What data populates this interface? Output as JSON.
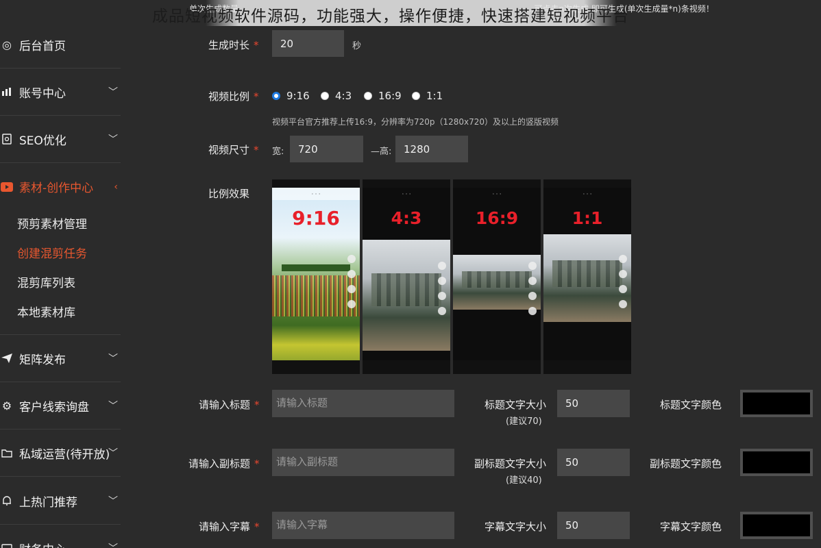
{
  "sidebar": {
    "items": [
      {
        "label": "后台首页",
        "icon": "target-icon"
      },
      {
        "label": "账号中心",
        "icon": "bar-chart-icon"
      },
      {
        "label": "SEO优化",
        "icon": "seo-doc-icon"
      },
      {
        "label": "素材-创作中心",
        "icon": "play-icon"
      },
      {
        "label": "矩阵发布",
        "icon": "send-icon"
      },
      {
        "label": "客户线索询盘",
        "icon": "gear-icon"
      },
      {
        "label": "私域运营(待开放)",
        "icon": "folder-icon"
      },
      {
        "label": "上热门推荐",
        "icon": "bell-icon"
      },
      {
        "label": "财务中心",
        "icon": "wallet-icon"
      }
    ],
    "subitems": [
      "预剪素材管理",
      "创建混剪任务",
      "混剪库列表",
      "本地素材库"
    ],
    "active_color": "#e8572f"
  },
  "watermark": "成品短视频软件源码，功能强大，操作便捷，快速搭建短视频平台",
  "top_notes": {
    "left": "单次生成数量",
    "right": "...可点击n次生成,即可生成(单次生成量*n)条视频！"
  },
  "form": {
    "duration": {
      "label": "生成时长",
      "value": "20",
      "unit": "秒"
    },
    "ratio": {
      "label": "视频比例",
      "options": [
        "9:16",
        "4:3",
        "16:9",
        "1:1"
      ],
      "selected": "9:16",
      "hint": "视频平台官方推荐上传16:9，分辨率为720p（1280x720）及以上的竖版视频"
    },
    "size": {
      "label": "视频尺寸",
      "width_label": "宽:",
      "width": "720",
      "height_label": "—高:",
      "height": "1280"
    },
    "preview": {
      "label": "比例效果",
      "ratios": [
        "9:16",
        "4:3",
        "16:9",
        "1:1"
      ]
    },
    "title": {
      "label": "请输入标题",
      "placeholder": "请输入标题",
      "size_label": "标题文字大小",
      "size_hint": "(建议70)",
      "size_value": "50",
      "color_label": "标题文字颜色"
    },
    "subtitle": {
      "label": "请输入副标题",
      "placeholder": "请输入副标题",
      "size_label": "副标题文字大小",
      "size_hint": "(建议40)",
      "size_value": "50",
      "color_label": "副标题文字颜色"
    },
    "caption": {
      "label": "请输入字幕",
      "placeholder": "请输入字幕",
      "size_label": "字幕文字大小",
      "size_value": "50",
      "color_label": "字幕文字颜色"
    },
    "required_mark": "*"
  }
}
